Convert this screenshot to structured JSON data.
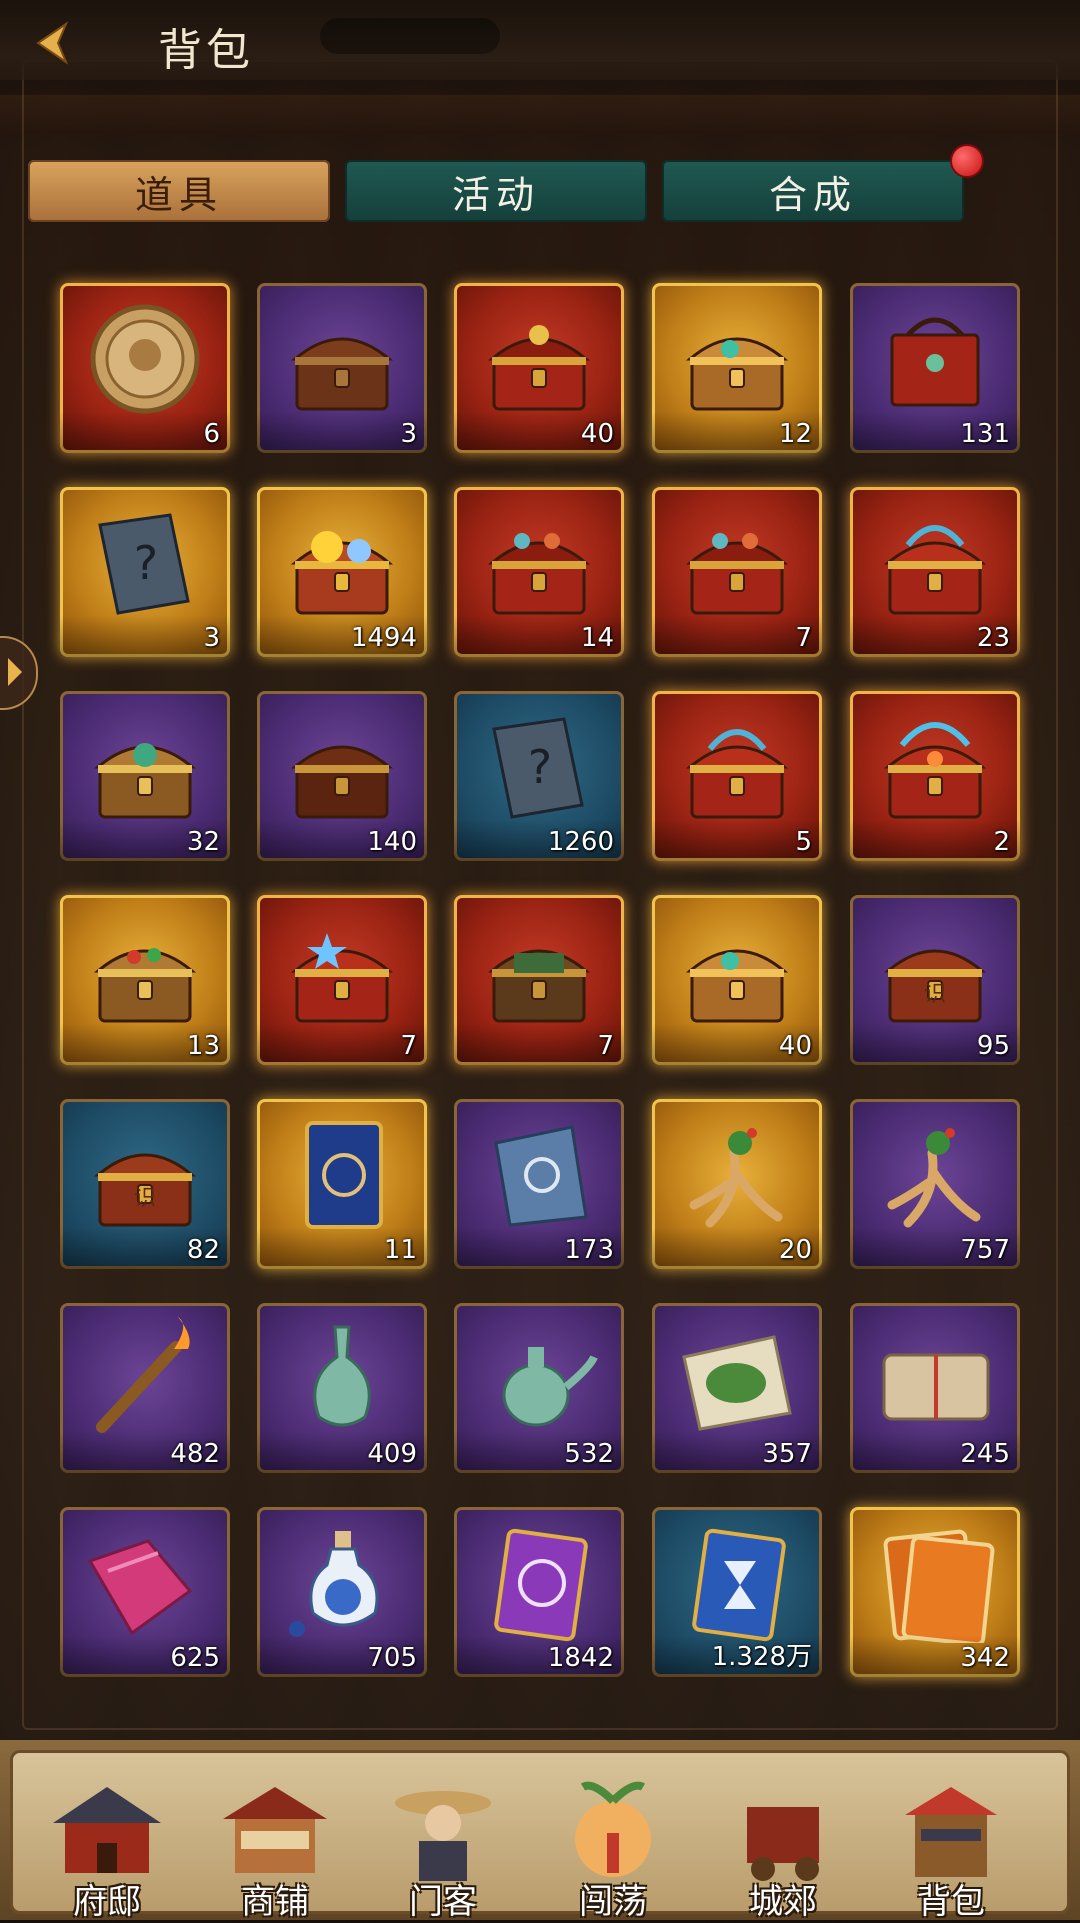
{
  "header": {
    "title": "背包"
  },
  "tabs": [
    {
      "label": "道具",
      "active": true
    },
    {
      "label": "活动",
      "active": false
    },
    {
      "label": "合成",
      "active": false,
      "badge": true
    }
  ],
  "items": [
    {
      "name": "gold-coin-icon",
      "quality": "red",
      "count": "6"
    },
    {
      "name": "wooden-chest-icon",
      "quality": "purple",
      "count": "3"
    },
    {
      "name": "treasure-chest-icon",
      "quality": "red",
      "count": "40"
    },
    {
      "name": "open-chest-icon",
      "quality": "gold",
      "count": "12"
    },
    {
      "name": "red-box-icon",
      "quality": "purple",
      "count": "131"
    },
    {
      "name": "mystery-book-icon",
      "quality": "gold",
      "count": "3"
    },
    {
      "name": "gem-chest-icon",
      "quality": "gold",
      "count": "1494"
    },
    {
      "name": "red-chest-icon",
      "quality": "red",
      "count": "14"
    },
    {
      "name": "red-chest-icon",
      "quality": "red",
      "count": "7"
    },
    {
      "name": "dragon-chest-icon",
      "quality": "red",
      "count": "23"
    },
    {
      "name": "jade-chest-icon",
      "quality": "purple",
      "count": "32"
    },
    {
      "name": "dark-chest-icon",
      "quality": "purple",
      "count": "140"
    },
    {
      "name": "mystery-book-icon",
      "quality": "blue",
      "count": "1260"
    },
    {
      "name": "dragon-chest-icon",
      "quality": "red",
      "count": "5"
    },
    {
      "name": "phoenix-chest-icon",
      "quality": "red",
      "count": "2"
    },
    {
      "name": "herb-chest-icon",
      "quality": "gold",
      "count": "13"
    },
    {
      "name": "star-chest-icon",
      "quality": "red",
      "count": "7"
    },
    {
      "name": "green-chest-icon",
      "quality": "red",
      "count": "7"
    },
    {
      "name": "open-chest-icon",
      "quality": "gold",
      "count": "40"
    },
    {
      "name": "seal-chest-icon",
      "quality": "purple",
      "count": "95"
    },
    {
      "name": "seal-chest-icon",
      "quality": "blue",
      "count": "82"
    },
    {
      "name": "blue-card-icon",
      "quality": "gold",
      "count": "11"
    },
    {
      "name": "blue-scroll-icon",
      "quality": "purple",
      "count": "173"
    },
    {
      "name": "ginseng-icon",
      "quality": "gold",
      "count": "20"
    },
    {
      "name": "ginseng-icon",
      "quality": "purple",
      "count": "757"
    },
    {
      "name": "torch-icon",
      "quality": "purple",
      "count": "482"
    },
    {
      "name": "vase-icon",
      "quality": "purple",
      "count": "409"
    },
    {
      "name": "teapot-icon",
      "quality": "purple",
      "count": "532"
    },
    {
      "name": "herb-leaves-icon",
      "quality": "purple",
      "count": "357"
    },
    {
      "name": "parcel-icon",
      "quality": "purple",
      "count": "245"
    },
    {
      "name": "pink-cloth-icon",
      "quality": "purple",
      "count": "625"
    },
    {
      "name": "potion-bottle-icon",
      "quality": "purple",
      "count": "705"
    },
    {
      "name": "purple-card-icon",
      "quality": "purple",
      "count": "1842"
    },
    {
      "name": "hourglass-card-icon",
      "quality": "blue",
      "count": "1.328万"
    },
    {
      "name": "recruit-card-icon",
      "quality": "gold",
      "count": "342"
    }
  ],
  "nav": [
    {
      "label": "府邸",
      "icon": "mansion-icon"
    },
    {
      "label": "商铺",
      "icon": "shop-icon"
    },
    {
      "label": "门客",
      "icon": "retainer-icon"
    },
    {
      "label": "闯荡",
      "icon": "adventure-icon"
    },
    {
      "label": "城郊",
      "icon": "outskirts-icon"
    },
    {
      "label": "背包",
      "icon": "backpack-icon"
    }
  ],
  "colors": {
    "gold": "#c07f18",
    "red": "#9b2313",
    "purple": "#4a2b72",
    "blue": "#1e4c66",
    "tab_active": "#d9a45e",
    "tab_inactive": "#1f5a52"
  }
}
